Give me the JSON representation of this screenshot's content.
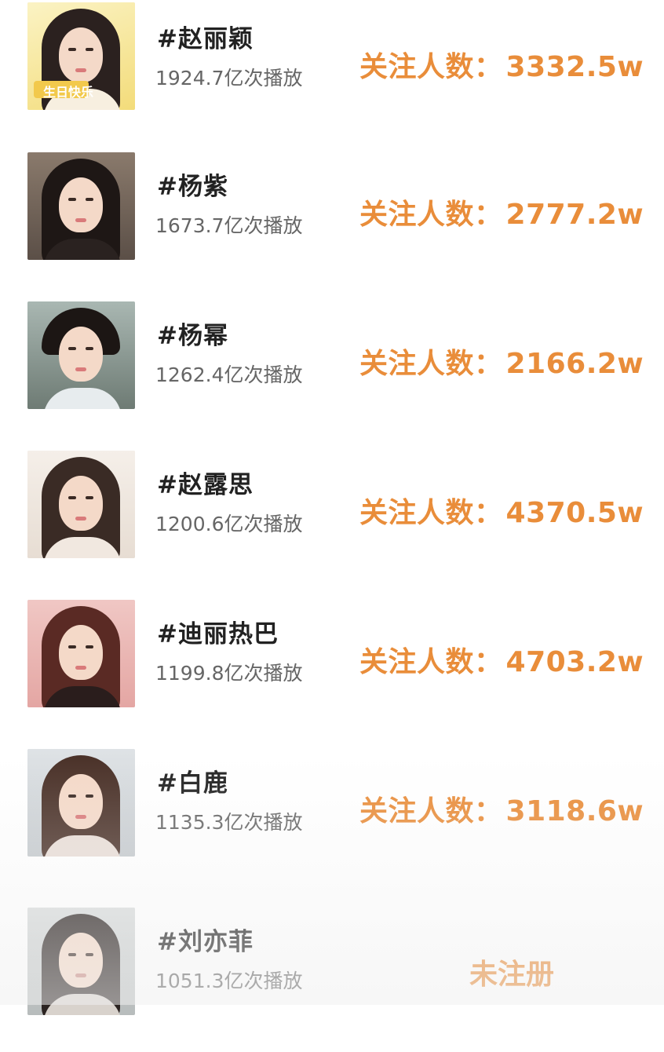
{
  "colors": {
    "accent": "#e98d3a",
    "name_text": "#222222",
    "sub_text": "#666666"
  },
  "rows": [
    {
      "name": "#赵丽颖",
      "plays": "1924.7亿次播放",
      "followers_label": "关注人数：",
      "followers_value": "3332.5w",
      "thumb_badge": "生日快乐",
      "thumb_overlay": "10 16",
      "avatar_icon": "portrait-yellow-birthday"
    },
    {
      "name": "#杨紫",
      "plays": "1673.7亿次播放",
      "followers_label": "关注人数：",
      "followers_value": "2777.2w",
      "avatar_icon": "portrait-dark-hair"
    },
    {
      "name": "#杨幂",
      "plays": "1262.4亿次播放",
      "followers_label": "关注人数：",
      "followers_value": "2166.2w",
      "avatar_icon": "portrait-qipao"
    },
    {
      "name": "#赵露思",
      "plays": "1200.6亿次播放",
      "followers_label": "关注人数：",
      "followers_value": "4370.5w",
      "avatar_icon": "portrait-light"
    },
    {
      "name": "#迪丽热巴",
      "plays": "1199.8亿次播放",
      "followers_label": "关注人数：",
      "followers_value": "4703.2w",
      "avatar_icon": "portrait-pink"
    },
    {
      "name": "#白鹿",
      "plays": "1135.3亿次播放",
      "followers_label": "关注人数：",
      "followers_value": "3118.6w",
      "avatar_icon": "portrait-flowers"
    },
    {
      "name": "#刘亦菲",
      "plays": "1051.3亿次播放",
      "status": "未注册",
      "avatar_icon": "portrait-closeup"
    }
  ]
}
